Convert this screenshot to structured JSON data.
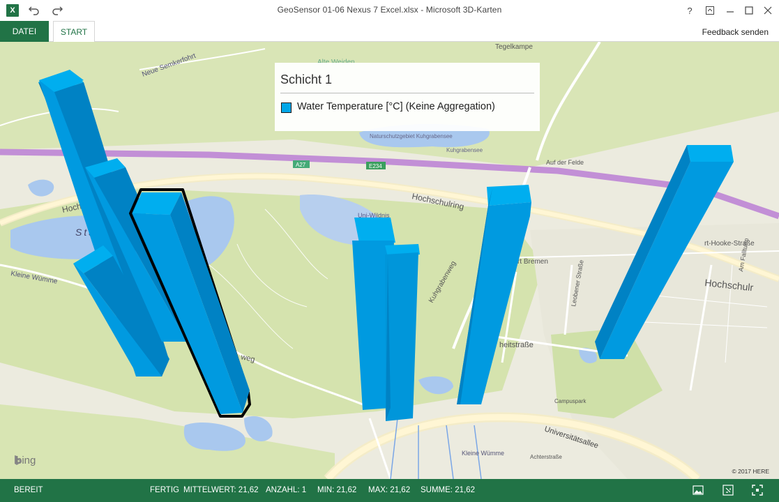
{
  "window": {
    "title": "GeoSensor 01-06 Nexus 7 Excel.xlsx - Microsoft 3D-Karten",
    "help_label": "?"
  },
  "ribbon": {
    "tabs": [
      "DATEI",
      "START"
    ],
    "feedback_label": "Feedback senden"
  },
  "legend": {
    "title": "Schicht 1",
    "series_label": "Water Temperature [°C] (Keine Aggregation)",
    "series_color": "#00a7e8"
  },
  "map": {
    "provider_logo": "bing",
    "copyright": "© 2017 HERE",
    "labels": {
      "tegelkampe": "Tegelkampe",
      "alte_weiden": "Alte Weiden",
      "neue_semkerfohrt": "Neue Semkerfohrt",
      "naturschutzgebiet": "Naturschutzgebiet Kuhgrabensee",
      "kuhgrabensee": "Kuhgrabensee",
      "a27": "A27",
      "e234": "E234",
      "hochschulring_left": "Hochsc",
      "hochschulring": "Hochschulring",
      "hochschulring_right": "Hochschulr",
      "uni_wildnis": "Uni-Wildnis",
      "stadt": "Stadt",
      "keine_wuemme": "Kleine Wümme",
      "kuhgrabenweg": "Kuhgrabenweg",
      "bremen": "rt Bremen",
      "hooke": "rt-Hooke-Straße",
      "heitstrasse": "heitstraße",
      "universitaetsallee": "Universitätsallee",
      "campuspark": "Campuspark",
      "kleine_wuemme_bottom": "Kleine Wümme",
      "achterstrasse": "Achterstraße",
      "weg": "weg",
      "leobener": "Leobener Straße",
      "am_fallturm": "Am Fallturm",
      "auf_der_felde": "Auf der Felde"
    },
    "columns_metric": "Water Temperature [°C]"
  },
  "status": {
    "ready": "BEREIT",
    "done": "FERTIG",
    "average": "MITTELWERT: 21,62",
    "count": "ANZAHL: 1",
    "min": "MIN: 21,62",
    "max": "MAX: 21,62",
    "sum": "SUMME: 21,62"
  },
  "colors": {
    "excel_green": "#217346",
    "column_front": "#0096da",
    "column_side": "#007bb8",
    "column_top": "#00aeef",
    "water": "#a9c8ee",
    "park": "#d6e4b0",
    "highway": "#c28fd6"
  },
  "icons": [
    "excel-icon",
    "undo-icon",
    "redo-icon",
    "help-icon",
    "restore-ribbon-icon",
    "minimize-icon",
    "maximize-icon",
    "close-icon",
    "screenshot-icon",
    "fit-map-icon",
    "fullscreen-icon"
  ]
}
